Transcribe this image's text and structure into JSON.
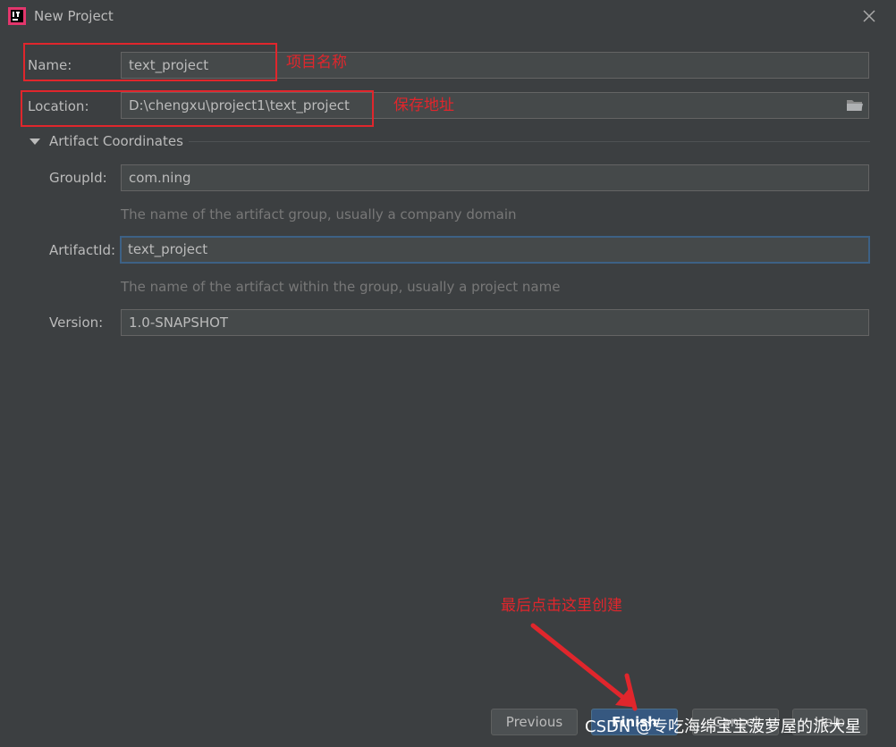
{
  "window": {
    "title": "New Project"
  },
  "form": {
    "name": {
      "label": "Name:",
      "value": "text_project"
    },
    "location": {
      "label": "Location:",
      "value": "D:\\chengxu\\project1\\text_project"
    },
    "section": {
      "label": "Artifact Coordinates"
    },
    "group_id": {
      "label": "GroupId:",
      "value": "com.ning",
      "hint": "The name of the artifact group, usually a company domain"
    },
    "artifact_id": {
      "label": "ArtifactId:",
      "value": "text_project",
      "hint": "The name of the artifact within the group, usually a project name"
    },
    "version": {
      "label": "Version:",
      "value": "1.0-SNAPSHOT"
    }
  },
  "annotations": {
    "name_note": "项目名称",
    "location_note": "保存地址",
    "finish_note": "最后点击这里创建"
  },
  "buttons": {
    "previous": "Previous",
    "finish": "Finish",
    "cancel": "Cancel",
    "help": "Help"
  },
  "watermark": "CSDN @专吃海绵宝宝菠萝屋的派大星",
  "icons": {
    "app": "intellij-logo-icon",
    "close": "close-icon",
    "folder": "folder-icon",
    "collapse": "triangle-down-icon"
  },
  "colors": {
    "background": "#3c3f41",
    "field": "#45494a",
    "annotation": "#e0262c",
    "primary_button": "#365880",
    "focus_border": "#3d6185"
  }
}
